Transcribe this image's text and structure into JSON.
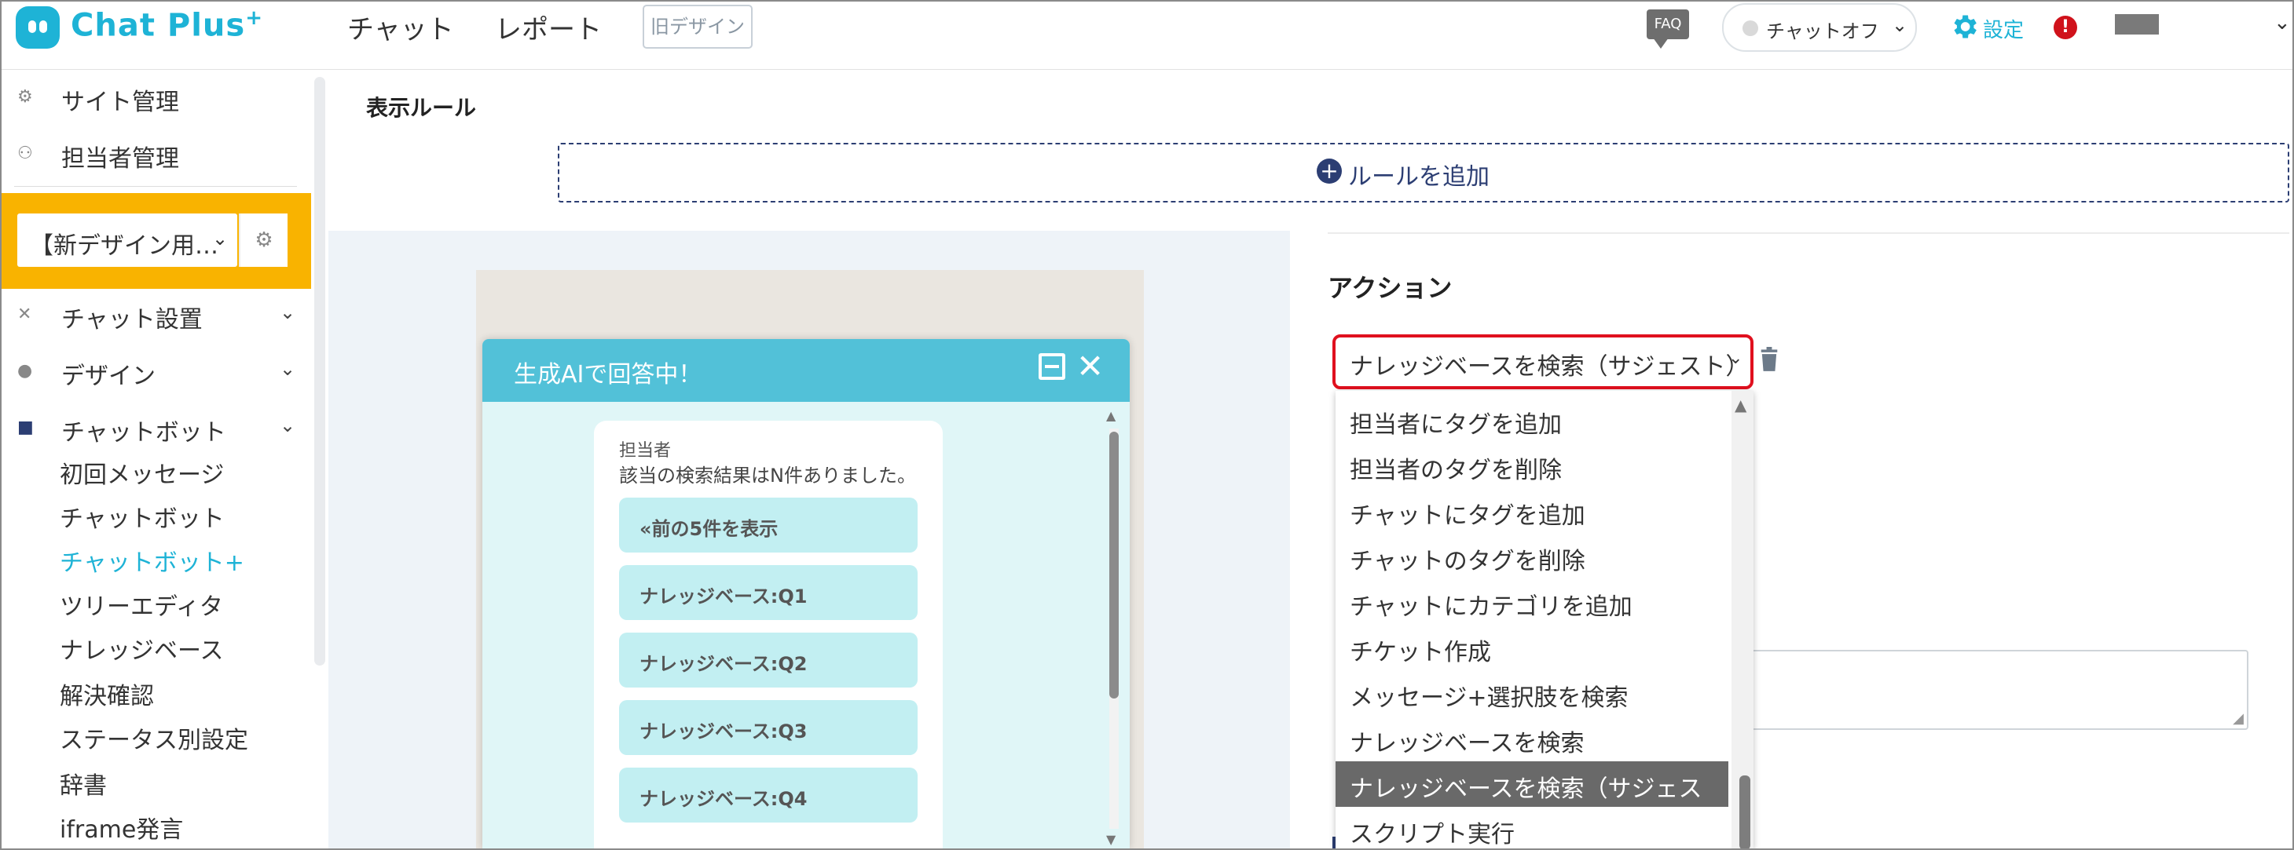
{
  "header": {
    "logo_text": "Chat Plus",
    "logo_sup": "+",
    "nav": [
      "チャット",
      "レポート"
    ],
    "old_design_label": "旧デザイン",
    "faq_label": "FAQ",
    "chat_status": "チャットオフ",
    "settings_label": "設定",
    "alert_mark": "!"
  },
  "sidebar": {
    "top_items": [
      {
        "label": "サイト管理",
        "icon": "gear-icon"
      },
      {
        "label": "担当者管理",
        "icon": "users-icon"
      }
    ],
    "site_select": "【新デザイン用…",
    "menu": [
      {
        "label": "チャット設置",
        "icon": "tools-icon"
      },
      {
        "label": "デザイン",
        "icon": "palette-icon"
      },
      {
        "label": "チャットボット",
        "icon": "chat-icon"
      }
    ],
    "sub_items": [
      "初回メッセージ",
      "チャットボット",
      "チャットボット+",
      "ツリーエディタ",
      "ナレッジベース",
      "解決確認",
      "ステータス別設定",
      "辞書",
      "iframe発言"
    ],
    "active_sub": "チャットボット+"
  },
  "main": {
    "rule_title": "表示ルール",
    "add_rule_label": "ルールを追加",
    "action_title": "アクション",
    "action_selected": "ナレッジベースを検索（サジェスト）",
    "dropdown_options": [
      "担当者にタグを追加",
      "担当者のタグを削除",
      "チャットにタグを追加",
      "チャットのタグを削除",
      "チャットにカテゴリを追加",
      "チケット作成",
      "メッセージ+選択肢を検索",
      "ナレッジベースを検索",
      "ナレッジベースを検索（サジェスト）",
      "スクリプト実行"
    ],
    "dropdown_highlighted": "ナレッジベースを検索（サジェスト）"
  },
  "preview": {
    "title": "生成AIで回答中！",
    "sender": "担当者",
    "message": "該当の検索結果はN件ありました。",
    "buttons": [
      "«前の5件を表示",
      "ナレッジベース:Q1",
      "ナレッジベース:Q2",
      "ナレッジベース:Q3",
      "ナレッジベース:Q4"
    ]
  },
  "colors": {
    "brand": "#1eb3d6",
    "sidebar_highlight": "#f9b300",
    "chat_header": "#52c1d8",
    "quick_reply": "#c2eff2",
    "focus_outline": "#e0101e",
    "accent_dark": "#2c3e73"
  }
}
